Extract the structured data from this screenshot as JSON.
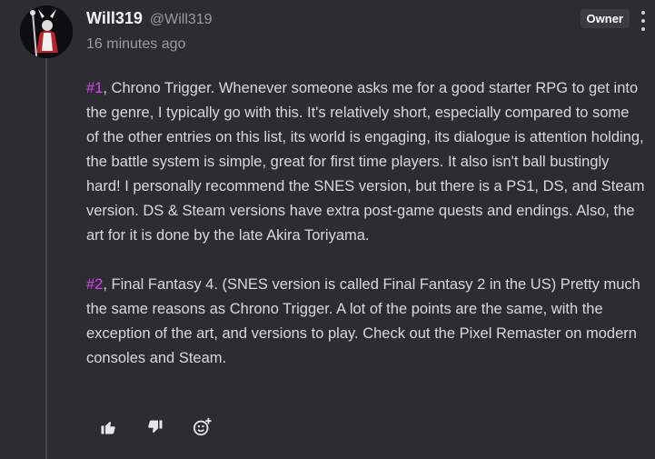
{
  "post": {
    "author": "Will319",
    "handle": "@Will319",
    "timestamp": "16 minutes ago",
    "badge": "Owner"
  },
  "paragraphs": [
    {
      "mention": "#1",
      "text": ", Chrono Trigger. Whenever someone asks me for a good starter RPG to get into the genre, I typically go with this. It's relatively short, especially compared to some of the other entries on this list, its world is engaging, its dialogue is attention holding, the battle system is simple, great for first time players. It also isn't ball bustingly hard! I personally recommend the SNES version, but there is a PS1, DS, and Steam version. DS & Steam versions have extra post-game quests and endings. Also, the art for it is done by the late Akira Toriyama."
    },
    {
      "mention": "#2",
      "text": ", Final Fantasy 4. (SNES version is called Final Fantasy 2 in the US) Pretty much the same reasons as Chrono Trigger. A lot of the points are the same, with the exception of the art, and versions to play. Check out the Pixel Remaster on modern consoles and Steam."
    }
  ],
  "actions": [
    {
      "icon": "thumbs-up-icon"
    },
    {
      "icon": "thumbs-down-icon"
    },
    {
      "icon": "add-reaction-icon"
    }
  ],
  "colors": {
    "background": "#2b2d31",
    "mention": "#e040fb",
    "text": "#d9d9d9",
    "muted": "#9a9ca3"
  }
}
